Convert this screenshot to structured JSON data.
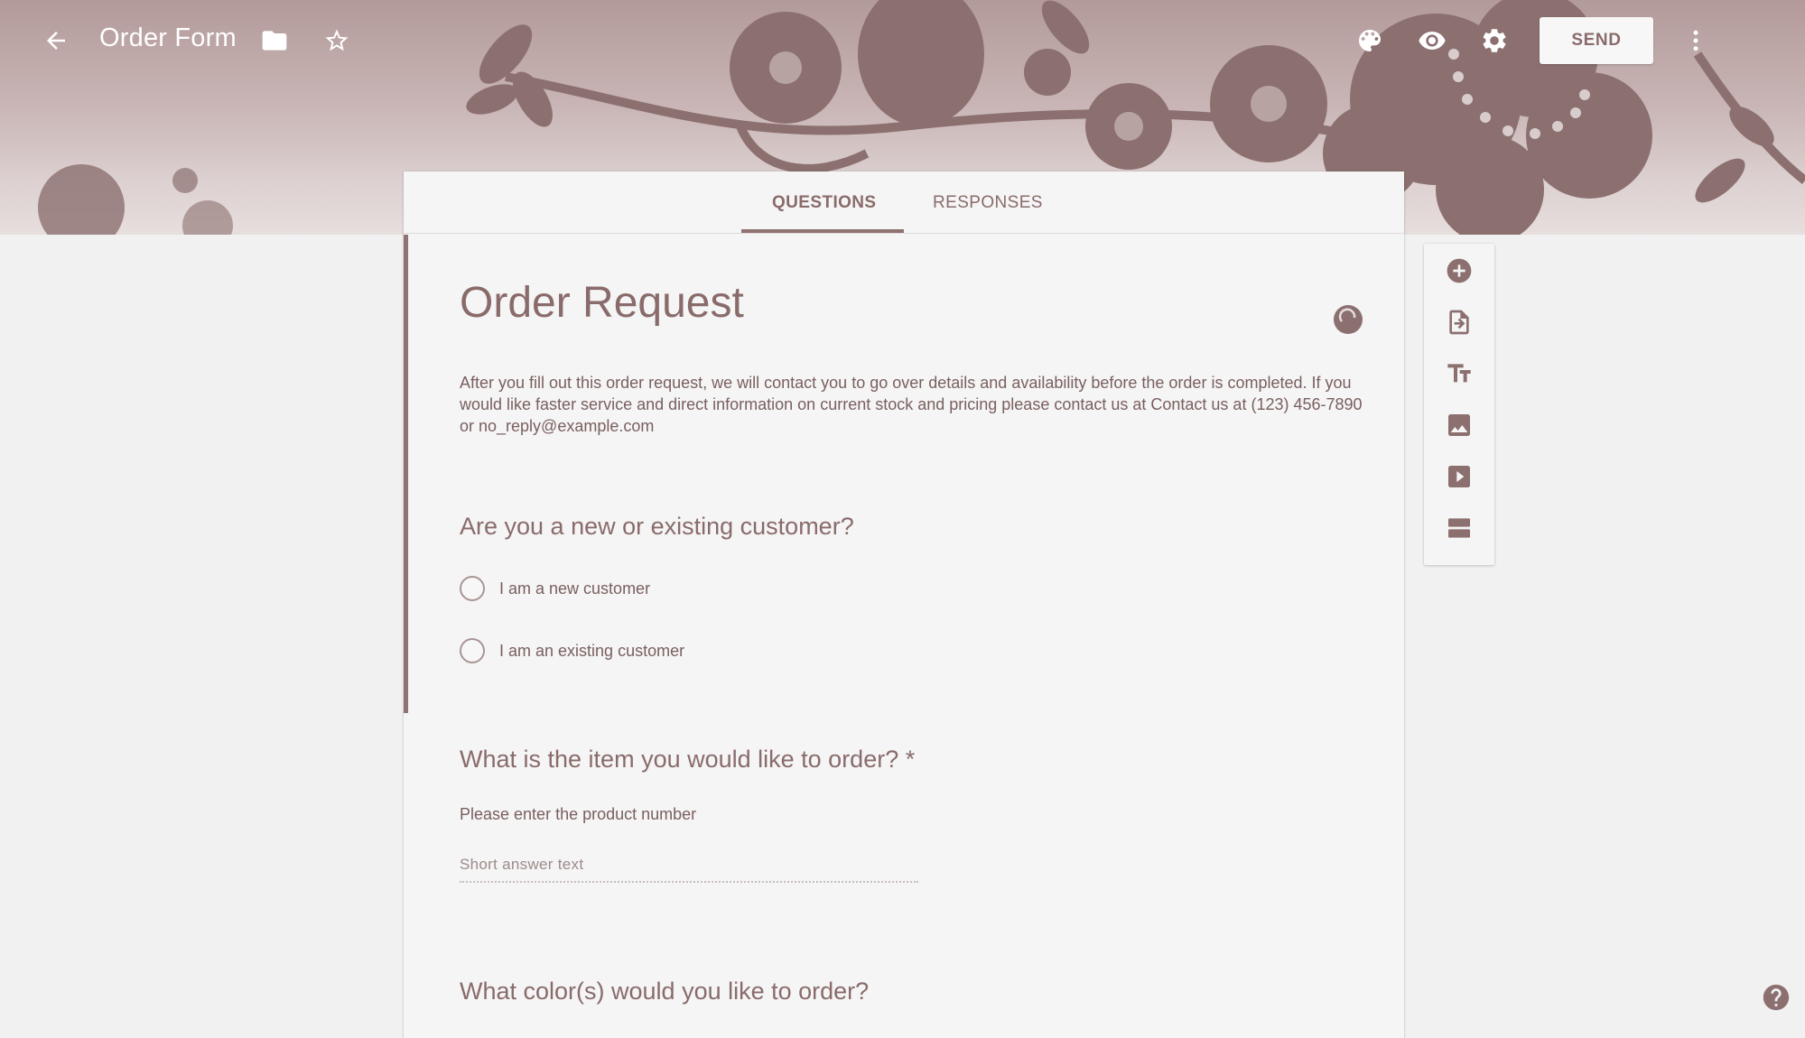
{
  "header": {
    "form_title": "Order Form",
    "send_label": "SEND",
    "icons": {
      "back": "arrow-back-icon",
      "folder": "folder-icon",
      "star": "star-icon",
      "palette": "palette-icon",
      "preview": "eye-icon",
      "settings": "gear-icon",
      "more": "more-vert-icon"
    }
  },
  "tabs": [
    {
      "label": "QUESTIONS",
      "active": true
    },
    {
      "label": "RESPONSES",
      "active": false
    }
  ],
  "form": {
    "title": "Order Request",
    "description": "After you fill out this order request, we will contact you to go over details and availability before the order is completed. If you would like faster service and direct information on current stock and pricing please contact us at Contact us at (123) 456-7890 or no_reply@example.com"
  },
  "questions": [
    {
      "title": "Are you a new or existing customer?",
      "type": "multiple-choice",
      "options": [
        "I am a new customer",
        "I am an existing customer"
      ]
    },
    {
      "title": "What is the item you would like to order? *",
      "type": "short-answer",
      "help_text": "Please enter the product number",
      "placeholder": "Short answer text"
    },
    {
      "title": "What color(s) would you like to order?"
    }
  ],
  "side_toolbar": [
    {
      "icon": "add-circle-icon",
      "label": "Add question"
    },
    {
      "icon": "import-icon",
      "label": "Import questions"
    },
    {
      "icon": "title-text-icon",
      "label": "Add title and description"
    },
    {
      "icon": "image-icon",
      "label": "Add image"
    },
    {
      "icon": "video-icon",
      "label": "Add video"
    },
    {
      "icon": "section-icon",
      "label": "Add section"
    }
  ],
  "colors": {
    "accent": "#8f7272",
    "header_text": "#ffffff",
    "page_bg": "#f1f1f1",
    "card_bg": "#f5f5f5"
  }
}
